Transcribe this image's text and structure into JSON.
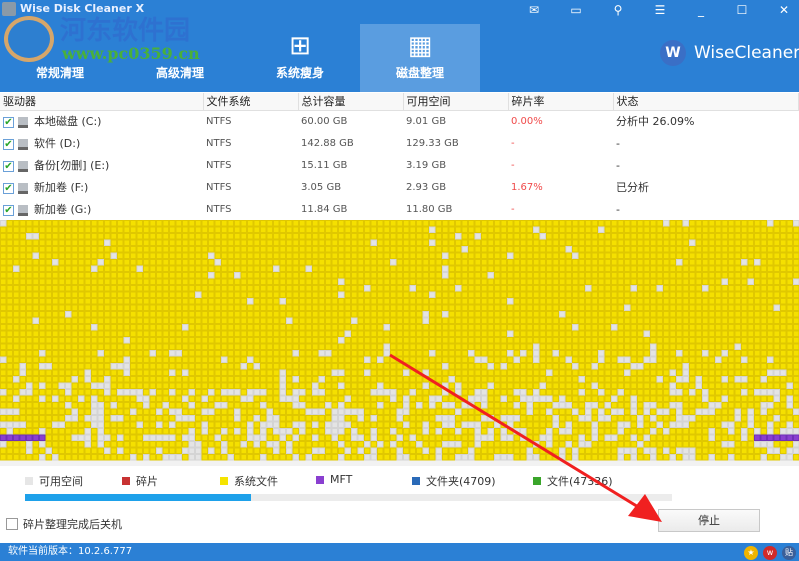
{
  "app": {
    "title": "Wise Disk Cleaner X",
    "brand": "WiseCleaner",
    "brand_icon_letter": "W"
  },
  "watermark": {
    "name": "河东软件园",
    "url": "www.pc0359.cn"
  },
  "window_buttons": [
    "mail-icon",
    "feedback-icon",
    "settings-icon",
    "menu-icon",
    "minimize-icon",
    "maximize-icon",
    "close-icon"
  ],
  "tabs": [
    {
      "label": "常规清理",
      "icon": "broom-icon"
    },
    {
      "label": "高级清理",
      "icon": "vacuum-icon"
    },
    {
      "label": "系统瘦身",
      "icon": "windows-icon"
    },
    {
      "label": "磁盘整理",
      "icon": "defrag-icon",
      "active": true
    }
  ],
  "table": {
    "headers": [
      "驱动器",
      "文件系统",
      "总计容量",
      "可用空间",
      "碎片率",
      "状态"
    ],
    "rows": [
      {
        "name": "本地磁盘 (C:)",
        "fs": "NTFS",
        "total": "60.00 GB",
        "free": "9.01 GB",
        "frag": "0.00%",
        "status": "分析中 26.09%",
        "checked": true
      },
      {
        "name": "软件 (D:)",
        "fs": "NTFS",
        "total": "142.88 GB",
        "free": "129.33 GB",
        "frag": "-",
        "status": "-",
        "checked": true
      },
      {
        "name": "备份[勿删] (E:)",
        "fs": "NTFS",
        "total": "15.11 GB",
        "free": "3.19 GB",
        "frag": "-",
        "status": "-",
        "checked": true
      },
      {
        "name": "新加卷 (F:)",
        "fs": "NTFS",
        "total": "3.05 GB",
        "free": "2.93 GB",
        "frag": "1.67%",
        "status": "已分析",
        "checked": true
      },
      {
        "name": "新加卷 (G:)",
        "fs": "NTFS",
        "total": "11.84 GB",
        "free": "11.80 GB",
        "frag": "-",
        "status": "-",
        "checked": true
      }
    ]
  },
  "legend": [
    {
      "label": "可用空间",
      "color": "#e6e6e6"
    },
    {
      "label": "碎片",
      "color": "#c83232"
    },
    {
      "label": "系统文件",
      "color": "#f5e400"
    },
    {
      "label": "MFT",
      "color": "#8a3fd0"
    },
    {
      "label": "文件夹(4709)",
      "color": "#2a6ab8"
    },
    {
      "label": "文件(47336)",
      "color": "#3aa52a"
    }
  ],
  "progress": {
    "percent": 35
  },
  "shutdown_label": "碎片整理完成后关机",
  "stop_label": "停止",
  "status": {
    "version_label": "软件当前版本：",
    "version": "10.2.6.777"
  }
}
